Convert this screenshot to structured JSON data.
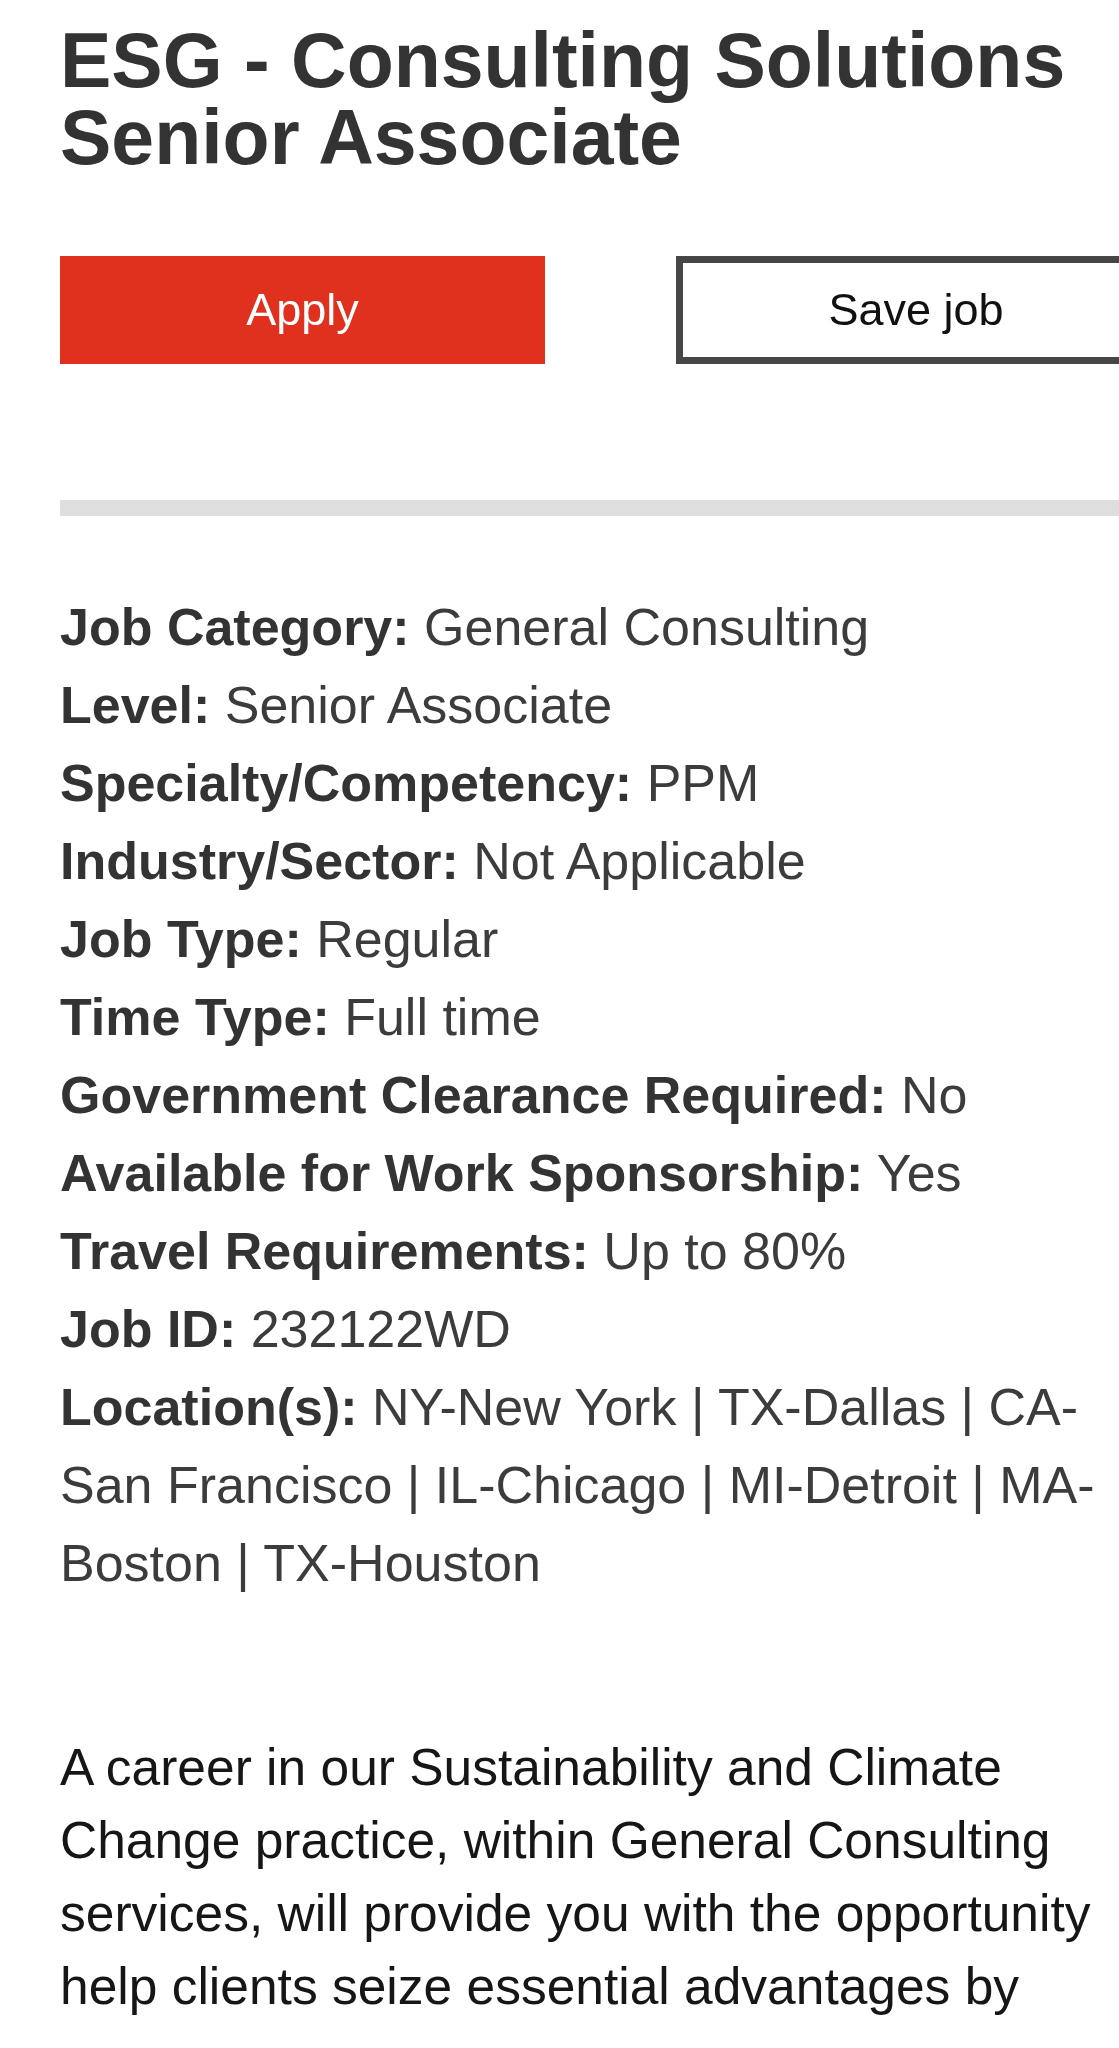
{
  "job": {
    "title": "ESG - Consulting Solutions Senior Associate"
  },
  "actions": [
    {
      "label": "Apply",
      "kind": "primary"
    },
    {
      "label": "Save job",
      "kind": "secondary"
    }
  ],
  "details": [
    "**Job Category:** General Consulting",
    "**Level:** Senior Associate",
    "**Specialty/Competency:** PPM",
    "**Industry/Sector:** Not Applicable",
    "**Job Type:** Regular",
    "**Time Type:** Full time",
    "**Government Clearance Required:** No",
    "**Available for Work Sponsorship:** Yes",
    "**Travel Requirements:** Up to 80%",
    "**Job ID:** 232122WD",
    "**Location(s):** NY-New York | TX-Dallas | CA-San Francisco | IL-Chicago | MI-Detroit | MA-Boston | TX-Houston"
  ],
  "description": "A career in our Sustainability and Climate Change practice, within General Consulting services, will provide you with the opportunity help clients seize essential advantages by"
}
